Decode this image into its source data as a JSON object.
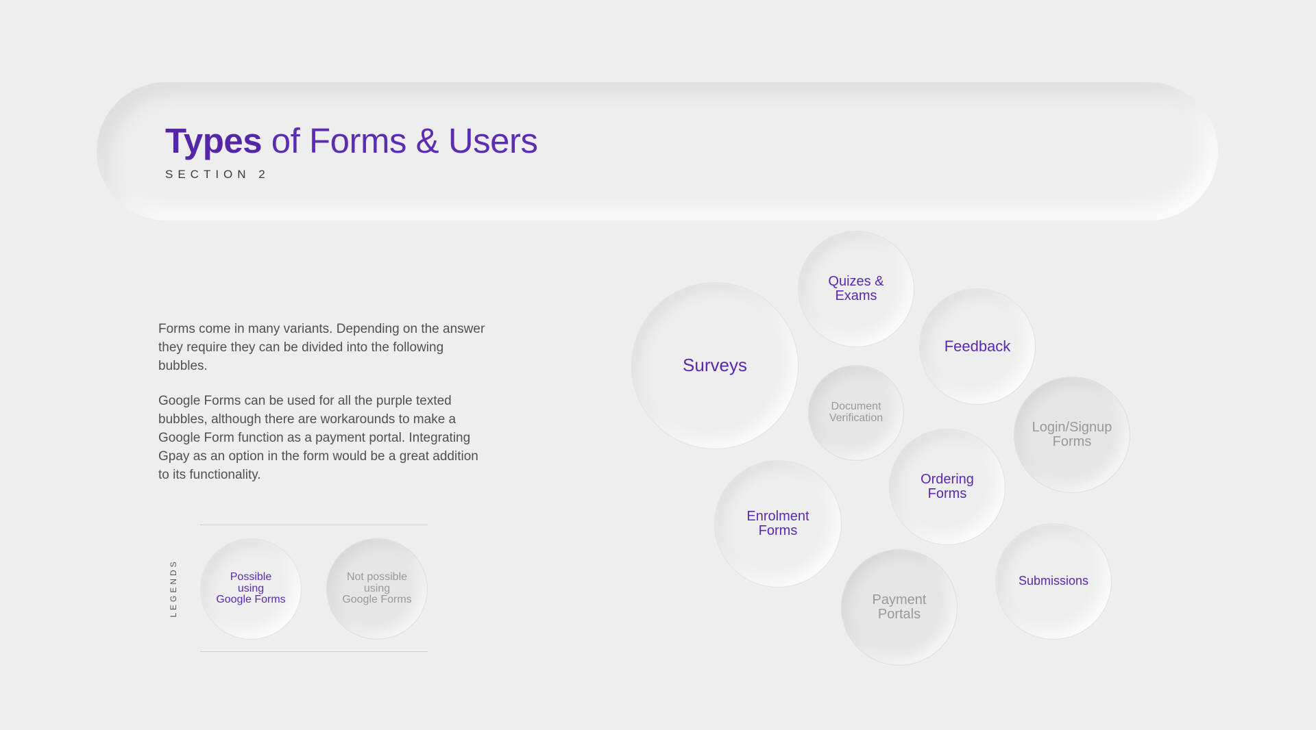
{
  "header": {
    "title_bold": "Types",
    "title_rest": " of Forms & Users",
    "subtitle": "SECTION 2"
  },
  "description": {
    "paragraph_1": "Forms come in many variants. Depending on the answer they require they can be divided into the following bubbles.",
    "paragraph_2": "Google Forms can be used for all the purple texted bubbles, although there are workarounds to make a Google Form function as a payment portal. Integrating Gpay as an option in the form would be a great addition to its functionality."
  },
  "legend": {
    "label": "LEGENDS",
    "possible": "Possible\nusing\nGoogle Forms",
    "not_possible": "Not possible\nusing\nGoogle Forms"
  },
  "bubbles": {
    "surveys": "Surveys",
    "quizes_exams": "Quizes &\nExams",
    "feedback": "Feedback",
    "document_verification": "Document\nVerification",
    "login_signup_forms": "Login/Signup\nForms",
    "ordering_forms": "Ordering\nForms",
    "enrolment_forms": "Enrolment\nForms",
    "payment_portals": "Payment\nPortals",
    "submissions": "Submissions"
  },
  "colors": {
    "background": "#eeeeee",
    "purple_text": "#5a28b0",
    "grey_text": "#989898",
    "body_text": "#505050"
  }
}
